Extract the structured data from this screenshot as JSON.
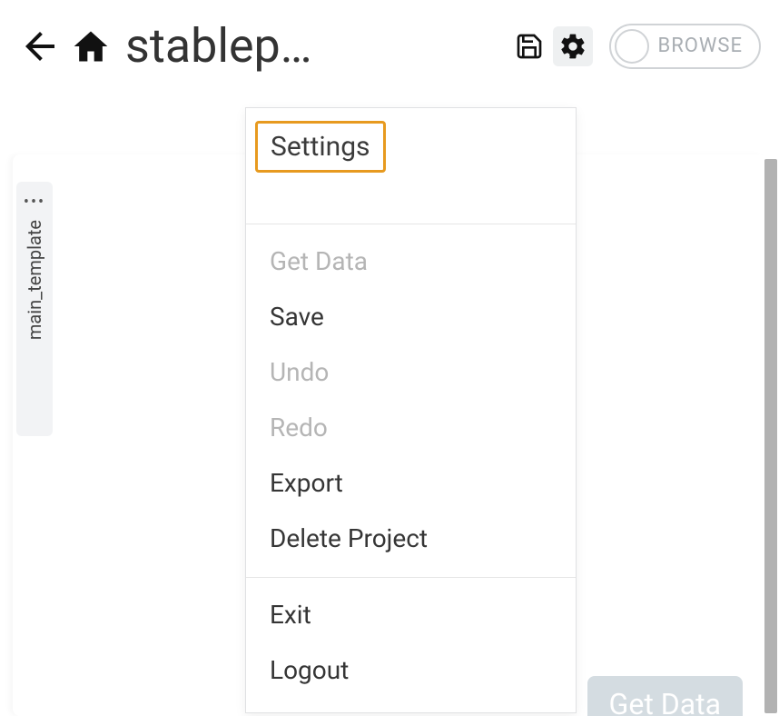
{
  "header": {
    "title": "stablep…",
    "toggle_label": "BROWSE"
  },
  "sidebar": {
    "tab_label": "main_template"
  },
  "menu": {
    "top": [
      {
        "label": "Settings",
        "enabled": true,
        "highlighted": true
      }
    ],
    "middle": [
      {
        "label": "Get Data",
        "enabled": false
      },
      {
        "label": "Save",
        "enabled": true
      },
      {
        "label": "Undo",
        "enabled": false
      },
      {
        "label": "Redo",
        "enabled": false
      },
      {
        "label": "Export",
        "enabled": true
      },
      {
        "label": "Delete Project",
        "enabled": true
      }
    ],
    "bottom": [
      {
        "label": "Exit",
        "enabled": true
      },
      {
        "label": "Logout",
        "enabled": true
      }
    ]
  },
  "buttons": {
    "get_data": "Get Data"
  }
}
